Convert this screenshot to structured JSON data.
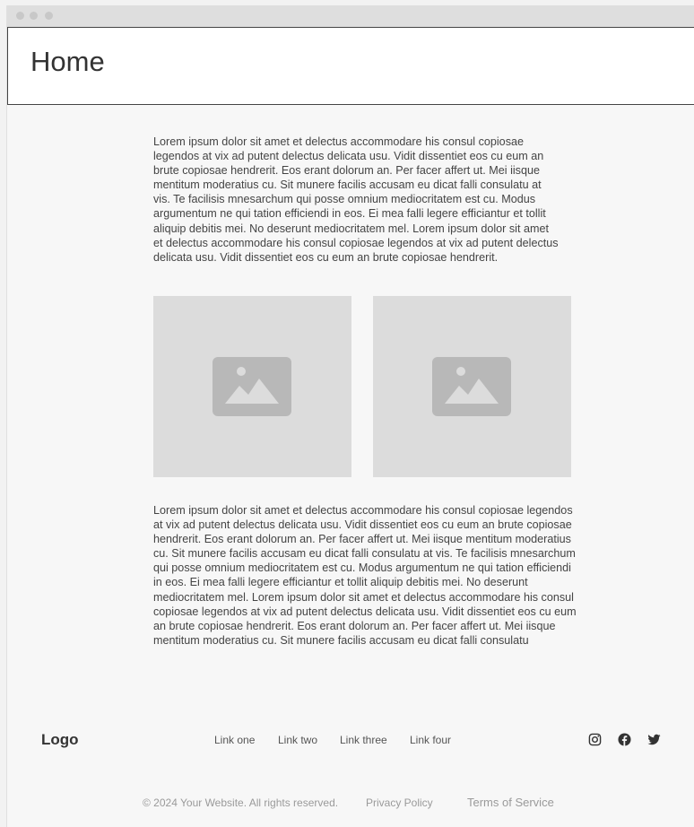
{
  "header": {
    "title": "Home"
  },
  "content": {
    "paragraph1": "Lorem ipsum dolor sit amet et delectus accommodare his consul copiosae legendos at vix ad putent delectus delicata usu. Vidit dissentiet eos cu eum an brute copiosae hendrerit. Eos erant dolorum an. Per facer affert ut. Mei iisque mentitum moderatius cu. Sit munere facilis accusam eu dicat falli consulatu at vis. Te facilisis mnesarchum qui posse omnium mediocritatem est cu. Modus argumentum ne qui tation efficiendi in eos. Ei mea falli legere efficiantur et tollit aliquip debitis mei. No deserunt mediocritatem mel. Lorem ipsum dolor sit amet et delectus accommodare his consul copiosae legendos at vix ad putent delectus delicata usu. Vidit dissentiet eos cu eum an brute copiosae hendrerit.",
    "images": [
      {
        "icon": "image-placeholder-icon"
      },
      {
        "icon": "image-placeholder-icon"
      }
    ],
    "paragraph2": "Lorem ipsum dolor sit amet et delectus accommodare his consul copiosae legendos at vix ad putent delectus delicata usu. Vidit dissentiet eos cu eum an brute copiosae hendrerit. Eos erant dolorum an. Per facer affert ut. Mei iisque mentitum moderatius cu. Sit munere facilis accusam eu dicat falli consulatu at vis. Te facilisis mnesarchum qui posse omnium mediocritatem est cu. Modus argumentum ne qui tation efficiendi in eos. Ei mea falli legere efficiantur et tollit aliquip debitis mei. No deserunt mediocritatem mel. Lorem ipsum dolor sit amet et delectus accommodare his consul copiosae legendos at vix ad putent delectus delicata usu. Vidit dissentiet eos cu eum an brute copiosae hendrerit. Eos erant dolorum an. Per facer affert ut. Mei iisque mentitum moderatius cu. Sit munere facilis accusam eu dicat falli consulatu"
  },
  "footer": {
    "logo": "Logo",
    "links": [
      "Link one",
      "Link two",
      "Link three",
      "Link four"
    ],
    "social": [
      "instagram-icon",
      "facebook-icon",
      "twitter-icon"
    ],
    "copyright": "© 2024 Your Website. All rights reserved.",
    "privacy": "Privacy Policy",
    "terms": "Terms of Service"
  },
  "colors": {
    "titlebar": "#dedede",
    "placeholder": "#dcdcdc",
    "placeholder_icon": "#b8b8b8",
    "text": "#444444"
  }
}
